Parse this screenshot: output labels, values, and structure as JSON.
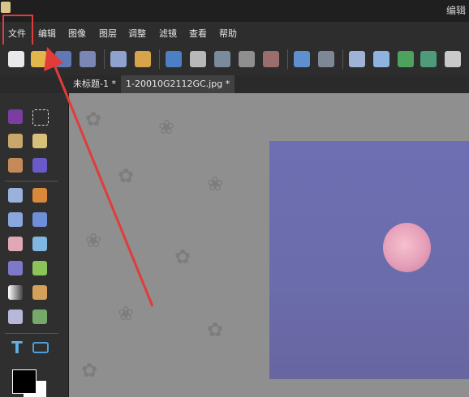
{
  "window": {
    "title": "编辑"
  },
  "menu": {
    "items": [
      "文件",
      "编辑",
      "图像",
      "图层",
      "调整",
      "滤镜",
      "查看",
      "帮助"
    ]
  },
  "tabs": [
    "未标题-1 *",
    "1-20010G2112GC.jpg *"
  ],
  "colors": {
    "annotation_red": "#e23b3b",
    "foreground": "#000000",
    "background": "#ffffff"
  }
}
